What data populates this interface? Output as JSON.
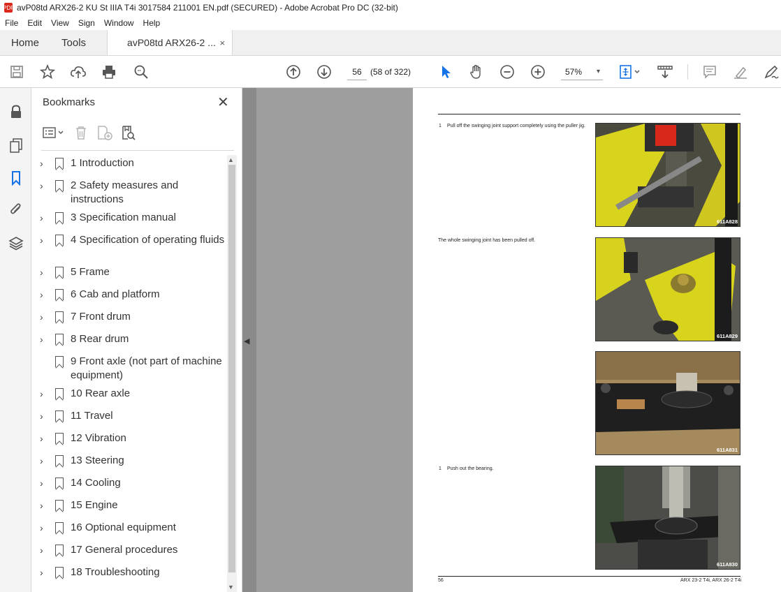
{
  "window": {
    "title": "avP08td ARX26-2 KU St IIIA T4i 3017584 211001 EN.pdf (SECURED) - Adobe Acrobat Pro DC (32-bit)",
    "pdf_badge": "PDF"
  },
  "menu": [
    "File",
    "Edit",
    "View",
    "Sign",
    "Window",
    "Help"
  ],
  "tabs": {
    "home": "Home",
    "tools": "Tools",
    "doc": "avP08td ARX26-2 ...",
    "doc_close": "×"
  },
  "toolbar": {
    "page_current": "56",
    "page_total": "(58 of 322)",
    "zoom": "57%",
    "zoom_caret": "▾"
  },
  "bookmarks": {
    "title": "Bookmarks",
    "close": "✕",
    "items": [
      {
        "label": "1 Introduction",
        "expand": "›"
      },
      {
        "label": "2 Safety measures and instructions",
        "expand": "›"
      },
      {
        "label": "3 Specification manual",
        "expand": "›"
      },
      {
        "label": "4 Specification of operating fluids",
        "expand": "›"
      },
      {
        "label": "5 Frame",
        "expand": "›"
      },
      {
        "label": "6 Cab and platform",
        "expand": "›"
      },
      {
        "label": "7 Front drum",
        "expand": "›"
      },
      {
        "label": "8 Rear drum",
        "expand": "›"
      },
      {
        "label": "9 Front axle (not part of machine equipment)",
        "expand": ""
      },
      {
        "label": "10 Rear axle",
        "expand": "›"
      },
      {
        "label": "11 Travel",
        "expand": "›"
      },
      {
        "label": "12 Vibration",
        "expand": "›"
      },
      {
        "label": "13 Steering",
        "expand": "›"
      },
      {
        "label": "14 Cooling",
        "expand": "›"
      },
      {
        "label": "15 Engine",
        "expand": "›"
      },
      {
        "label": "16 Optional equipment",
        "expand": "›"
      },
      {
        "label": "17 General procedures",
        "expand": "›"
      },
      {
        "label": "18 Troubleshooting",
        "expand": "›"
      }
    ]
  },
  "page": {
    "step1_num": "1",
    "step1_text": "Pull off the swinging joint support completely using the puller jig.",
    "note_text": "The whole swinging joint has been pulled off.",
    "step2_num": "1",
    "step2_text": "Push out the bearing.",
    "photos": [
      {
        "caption": "611A828"
      },
      {
        "caption": "611A829"
      },
      {
        "caption": "611A831"
      },
      {
        "caption": "611A830"
      }
    ],
    "footer_left": "56",
    "footer_right": "ARX 23-2 T4i, ARX 26-2 T4i"
  }
}
